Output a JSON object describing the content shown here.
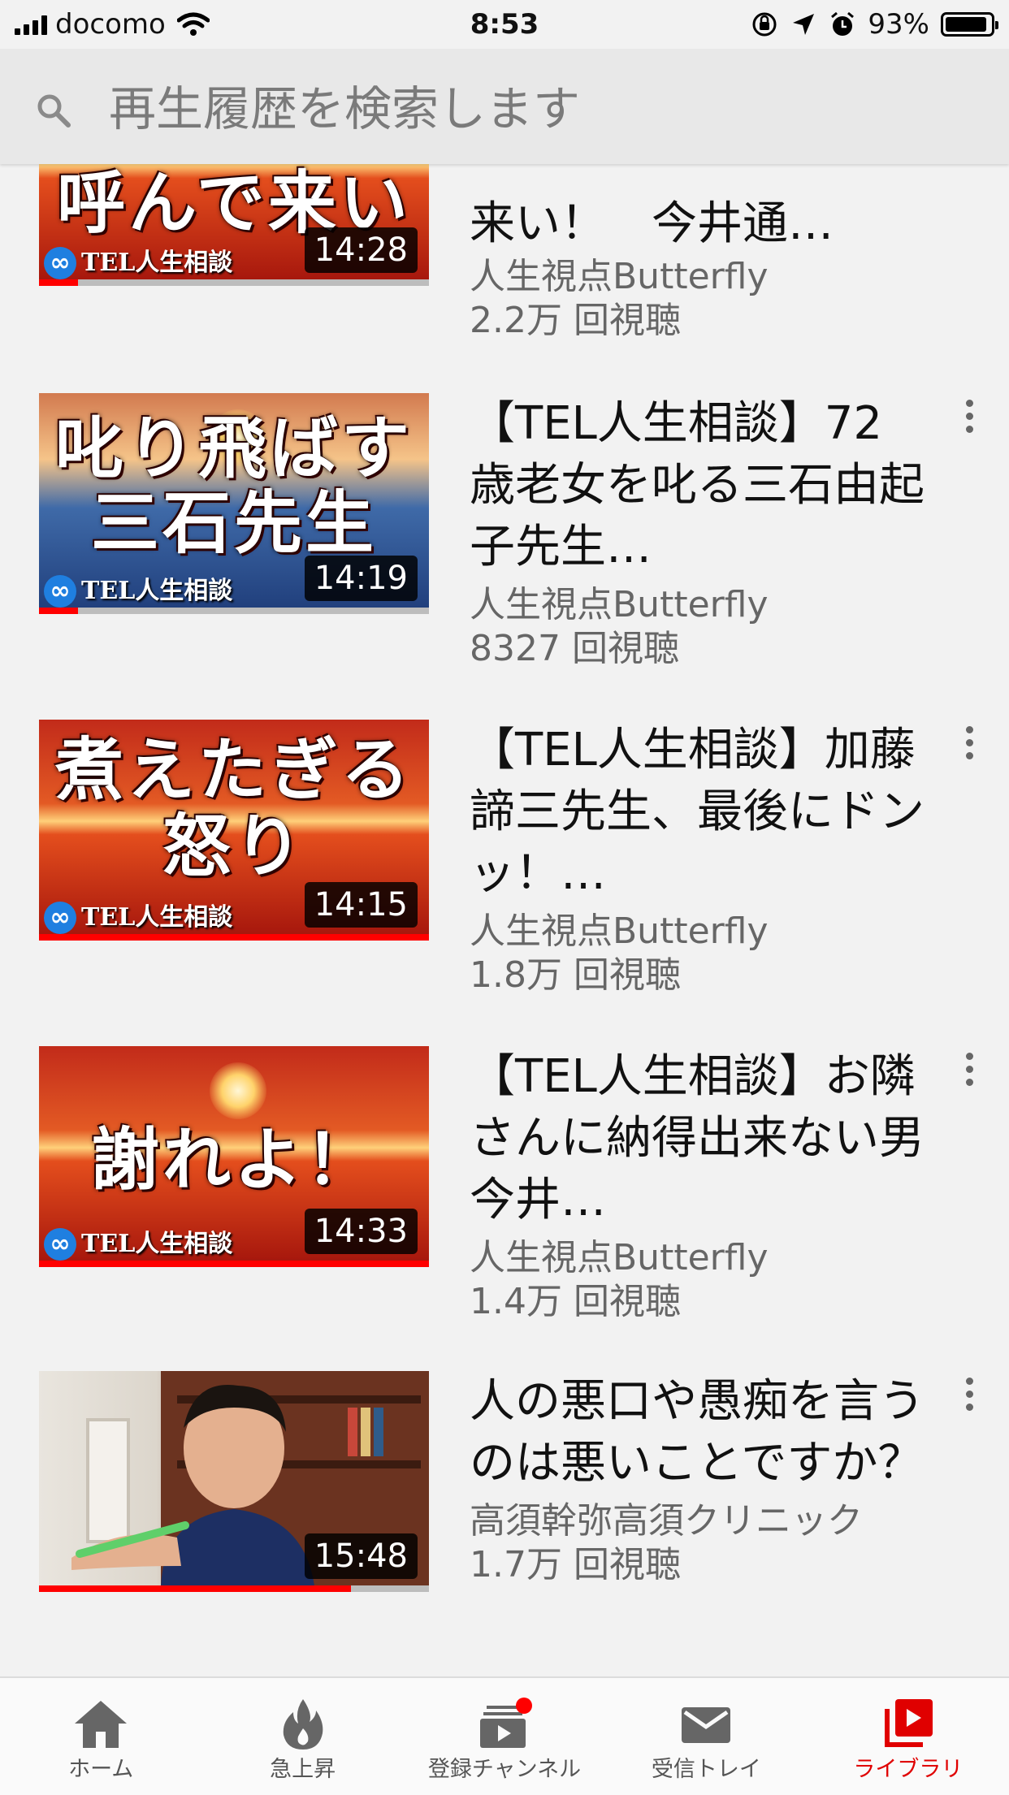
{
  "status_bar": {
    "carrier": "docomo",
    "time": "8:53",
    "battery_percent": "93%",
    "battery_level": 0.93
  },
  "search": {
    "placeholder": "再生履歴を検索します"
  },
  "videos": [
    {
      "thumb_caption": [
        "呼んで来い"
      ],
      "badge_text": "TEL人生相談",
      "duration": "14:28",
      "progress": 0.1,
      "title_visible": "来い！　今井通…",
      "channel": "人生視点Butterfly",
      "views": "2.2万 回視聴"
    },
    {
      "thumb_caption": [
        "叱り飛ばす",
        "三石先生"
      ],
      "badge_text": "TEL人生相談",
      "duration": "14:19",
      "progress": 0.1,
      "title": "【TEL人生相談】72歳老女を叱る三石由起子先生…",
      "channel": "人生視点Butterfly",
      "views": "8327 回視聴"
    },
    {
      "thumb_caption": [
        "煮えたぎる",
        "怒り"
      ],
      "badge_text": "TEL人生相談",
      "duration": "14:15",
      "progress": 1.0,
      "title": "【TEL人生相談】加藤諦三先生、最後にドンッ！…",
      "channel": "人生視点Butterfly",
      "views": "1.8万 回視聴"
    },
    {
      "thumb_caption": [
        "謝れよ！"
      ],
      "badge_text": "TEL人生相談",
      "duration": "14:33",
      "progress": 1.0,
      "title": "【TEL人生相談】お隣さんに納得出来ない男　今井…",
      "channel": "人生視点Butterfly",
      "views": "1.4万 回視聴"
    },
    {
      "thumb_caption": [],
      "duration": "15:48",
      "progress": 0.8,
      "title": "人の悪口や愚痴を言うのは悪いことですか？",
      "channel": "高須幹弥高須クリニック",
      "views": "1.7万 回視聴"
    }
  ],
  "bottom_nav": [
    {
      "label": "ホーム",
      "icon": "home-icon"
    },
    {
      "label": "急上昇",
      "icon": "fire-icon"
    },
    {
      "label": "登録チャンネル",
      "icon": "subscriptions-icon"
    },
    {
      "label": "受信トレイ",
      "icon": "mail-icon"
    },
    {
      "label": "ライブラリ",
      "icon": "library-icon",
      "active": true
    }
  ],
  "colors": {
    "accent": "#ff0000",
    "active_nav": "#e00000",
    "text_secondary": "#666666",
    "background": "#f2f2f2"
  }
}
